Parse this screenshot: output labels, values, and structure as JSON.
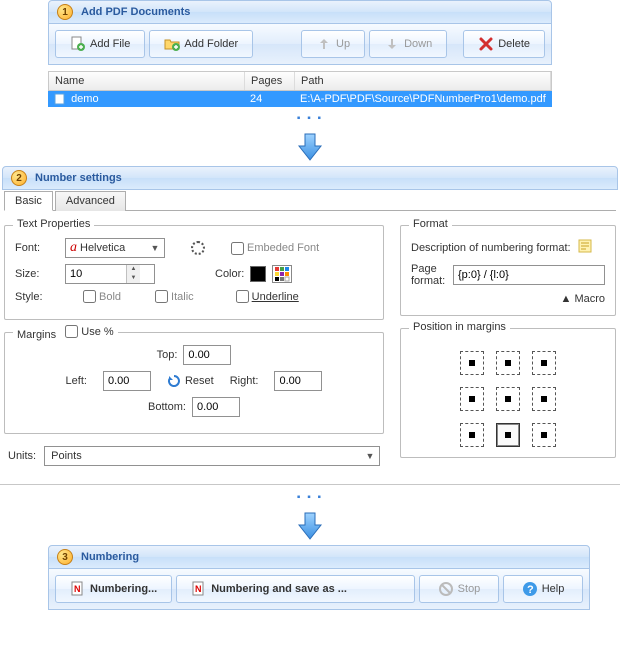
{
  "section1": {
    "title": "Add PDF Documents",
    "badge": "1",
    "toolbar": {
      "add_file": "Add File",
      "add_folder": "Add Folder",
      "up": "Up",
      "down": "Down",
      "delete": "Delete"
    },
    "columns": {
      "name": "Name",
      "pages": "Pages",
      "path": "Path"
    },
    "rows": [
      {
        "name": "demo",
        "pages": "24",
        "path": "E:\\A-PDF\\PDF\\Source\\PDFNumberPro1\\demo.pdf"
      }
    ]
  },
  "section2": {
    "title": "Number settings",
    "badge": "2",
    "tabs": {
      "basic": "Basic",
      "advanced": "Advanced"
    },
    "text_properties": {
      "legend": "Text Properties",
      "font_label": "Font:",
      "font_value": "Helvetica",
      "embedded_font": "Embeded Font",
      "size_label": "Size:",
      "size_value": "10",
      "color_label": "Color:",
      "style_label": "Style:",
      "bold": "Bold",
      "italic": "Italic",
      "underline": "Underline"
    },
    "format": {
      "legend": "Format",
      "desc_label": "Description of numbering format:",
      "page_format_label": "Page format:",
      "page_format_value": "{p:0} / {l:0}",
      "macro": "Macro"
    },
    "margins": {
      "legend": "Margins",
      "use_percent": "Use %",
      "top": "Top:",
      "top_v": "0.00",
      "left": "Left:",
      "left_v": "0.00",
      "right": "Right:",
      "right_v": "0.00",
      "bottom": "Bottom:",
      "bottom_v": "0.00",
      "reset": "Reset"
    },
    "position": {
      "legend": "Position in margins"
    },
    "units": {
      "label": "Units:",
      "value": "Points"
    }
  },
  "section3": {
    "title": "Numbering",
    "badge": "3",
    "toolbar": {
      "numbering": "Numbering...",
      "numbering_save_as": "Numbering and save as ...",
      "stop": "Stop",
      "help": "Help"
    }
  }
}
